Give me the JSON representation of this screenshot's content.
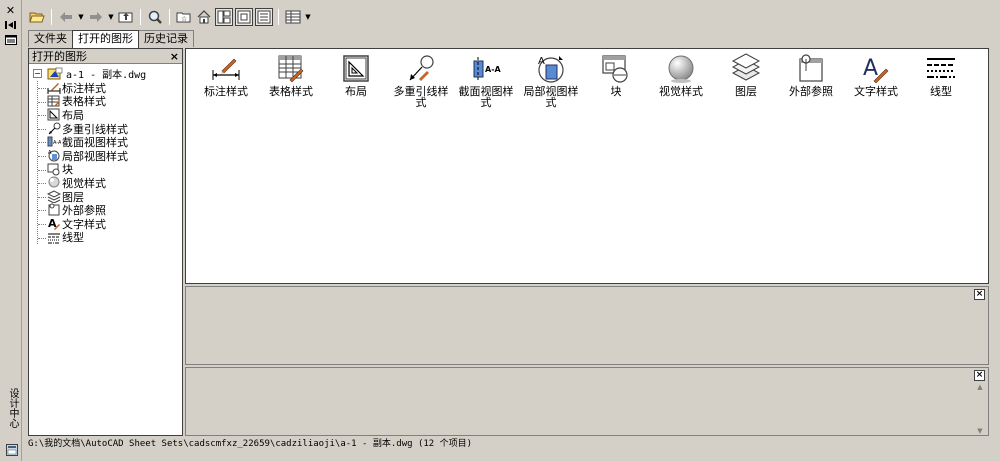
{
  "palette": {
    "title": "设计中心"
  },
  "toolbar": {
    "icons": [
      "open-icon",
      "back-icon",
      "forward-icon",
      "up-icon",
      "search-icon",
      "favorites-icon",
      "home-icon",
      "tree-toggle-icon",
      "preview-icon",
      "description-icon",
      "views-icon"
    ]
  },
  "tabs": [
    {
      "label": "文件夹",
      "active": false
    },
    {
      "label": "打开的图形",
      "active": true
    },
    {
      "label": "历史记录",
      "active": false
    }
  ],
  "tree": {
    "header": "打开的图形",
    "close": "×",
    "expander": "−",
    "root": "a-1 - 副本.dwg",
    "items": [
      "标注样式",
      "表格样式",
      "布局",
      "多重引线样式",
      "截面视图样式",
      "局部视图样式",
      "块",
      "视觉样式",
      "图层",
      "外部参照",
      "文字样式",
      "线型"
    ]
  },
  "content": {
    "items": [
      "标注样式",
      "表格样式",
      "布局",
      "多重引线样式",
      "截面视图样式",
      "局部视图样式",
      "块",
      "视觉样式",
      "图层",
      "外部参照",
      "文字样式",
      "线型"
    ]
  },
  "panes": {
    "close": "×"
  },
  "status": {
    "path": "G:\\我的文档\\AutoCAD Sheet Sets\\cadscmfxz_22659\\cadziliaoji\\a-1 - 副本.dwg (12 个项目)"
  }
}
